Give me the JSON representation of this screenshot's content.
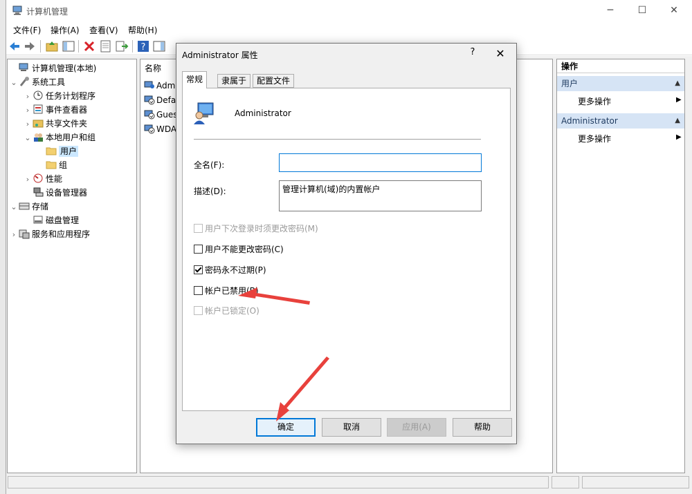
{
  "window": {
    "title": "计算机管理",
    "menu": [
      "文件(F)",
      "操作(A)",
      "查看(V)",
      "帮助(H)"
    ]
  },
  "tree": {
    "items": [
      {
        "label": "计算机管理(本地)",
        "icon": "computer-icon"
      },
      {
        "label": "系统工具",
        "icon": "tools-icon"
      },
      {
        "label": "任务计划程序",
        "icon": "clock-icon"
      },
      {
        "label": "事件查看器",
        "icon": "event-viewer-icon"
      },
      {
        "label": "共享文件夹",
        "icon": "shared-folder-icon"
      },
      {
        "label": "本地用户和组",
        "icon": "users-icon"
      },
      {
        "label": "用户",
        "icon": "folder-icon"
      },
      {
        "label": "组",
        "icon": "folder-icon"
      },
      {
        "label": "性能",
        "icon": "performance-icon"
      },
      {
        "label": "设备管理器",
        "icon": "device-manager-icon"
      },
      {
        "label": "存储",
        "icon": "storage-icon"
      },
      {
        "label": "磁盘管理",
        "icon": "disk-icon"
      },
      {
        "label": "服务和应用程序",
        "icon": "services-icon"
      }
    ]
  },
  "list": {
    "header": "名称",
    "rows": [
      "Admi",
      "Defau",
      "Gues",
      "WDA"
    ]
  },
  "actions": {
    "title": "操作",
    "sections": [
      {
        "label": "用户",
        "item": "更多操作"
      },
      {
        "label": "Administrator",
        "item": "更多操作"
      }
    ]
  },
  "dialog": {
    "title": "Administrator 属性",
    "help": "?",
    "close": "✕",
    "tabs": [
      "常规",
      "隶属于",
      "配置文件"
    ],
    "user_name": "Administrator",
    "fullname_label": "全名(F):",
    "fullname_value": "",
    "description_label": "描述(D):",
    "description_value": "管理计算机(域)的内置帐户",
    "checkboxes": [
      {
        "label": "用户下次登录时须更改密码(M)",
        "checked": false,
        "disabled": true
      },
      {
        "label": "用户不能更改密码(C)",
        "checked": false,
        "disabled": false
      },
      {
        "label": "密码永不过期(P)",
        "checked": true,
        "disabled": false
      },
      {
        "label": "帐户已禁用(B)",
        "checked": false,
        "disabled": false
      },
      {
        "label": "帐户已锁定(O)",
        "checked": false,
        "disabled": true
      }
    ],
    "buttons": {
      "ok": "确定",
      "cancel": "取消",
      "apply": "应用(A)",
      "help": "帮助"
    }
  },
  "colors": {
    "annotation_arrow": "#e8413c",
    "accent": "#0078d7"
  }
}
